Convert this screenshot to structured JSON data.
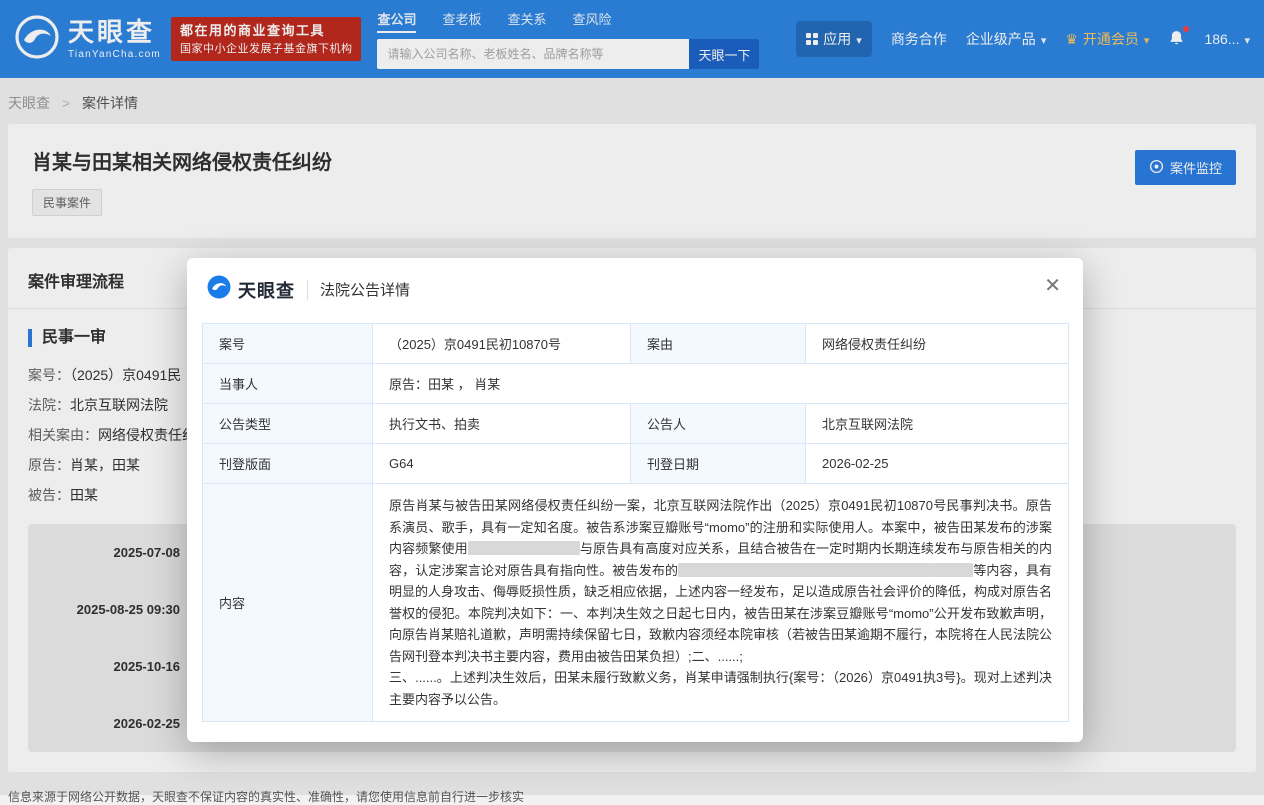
{
  "brand": {
    "name": "天眼查",
    "domain": "TianYanCha.com"
  },
  "header": {
    "badge_line1": "都在用的商业查询工具",
    "badge_line2": "国家中小企业发展子基金旗下机构",
    "search_tabs": [
      {
        "label": "查公司"
      },
      {
        "label": "查老板"
      },
      {
        "label": "查关系"
      },
      {
        "label": "查风险"
      }
    ],
    "search_placeholder": "请输入公司名称、老板姓名、品牌名称等",
    "search_button": "天眼一下",
    "nav_app": "应用",
    "nav_biz": "商务合作",
    "nav_enterprise": "企业级产品",
    "nav_vip": "开通会员",
    "nav_phone": "186..."
  },
  "breadcrumb": {
    "home": "天眼查",
    "separator": ">",
    "current": "案件详情"
  },
  "case_header": {
    "title": "肖某与田某相关网络侵权责任纠纷",
    "tag": "民事案件",
    "monitor_button": "案件监控"
  },
  "case_flow": {
    "section_title": "案件审理流程",
    "stage": "民事一审",
    "fields": [
      {
        "label": "案号：",
        "value": "（2025）京0491民"
      },
      {
        "label": "法院：",
        "value": "北京互联网法院"
      },
      {
        "label": "相关案由：",
        "value": "网络侵权责任纠"
      },
      {
        "label": "原告：",
        "value": "肖某，田某"
      },
      {
        "label": "被告：",
        "value": "田某"
      }
    ],
    "timeline": [
      {
        "date": "2025-07-08"
      },
      {
        "date": "2025-08-25 09:30"
      },
      {
        "date": "2025-10-16"
      },
      {
        "date": "2026-02-25"
      }
    ]
  },
  "modal": {
    "brand": "天眼查",
    "title": "法院公告详情",
    "close_icon": "✕",
    "table": {
      "row1": {
        "label1": "案号",
        "value1": "（2025）京0491民初10870号",
        "label2": "案由",
        "value2": "网络侵权责任纠纷"
      },
      "row2": {
        "label1": "当事人",
        "value1": "原告：田某 ， 肖某"
      },
      "row3": {
        "label1": "公告类型",
        "value1": "执行文书、拍卖",
        "label2": "公告人",
        "value2": "北京互联网法院"
      },
      "row4": {
        "label1": "刊登版面",
        "value1": "G64",
        "label2": "刊登日期",
        "value2": "2026-02-25"
      },
      "row5_label": "内容"
    },
    "content_segments": [
      {
        "text": "原告肖某与被告田某网络侵权责任纠纷一案，北京互联网法院作出（2025）京0491民初10870号民事判决书。原告系演员、歌手，具有一定知名度。被告系涉案豆瓣账号“momo”的注册和实际使用人。本案中，被告田某发布的涉案内容频繁使用"
      },
      {
        "redact": 112
      },
      {
        "text": "与原告具有高度对应关系，且结合被告在一定时期内长期连续发布与原告相关的内容，认定涉案言论对原告具有指向性。被告发布的"
      },
      {
        "redact": 255
      },
      {
        "redact": 40
      },
      {
        "text": "等内容，具有明显的人身攻击、侮辱贬损性质，缺乏相应依据，上述内容一经发布，足以造成原告社会评价的降低，构成对原告名誉权的侵犯。本院判决如下：一、本判决生效之日起七日内，被告田某在涉案豆瓣账号“momo”公开发布致歉声明，向原告肖某赔礼道歉，声明需持续保留七日，致歉内容须经本院审核（若被告田某逾期不履行，本院将在人民法院公告网刊登本判决书主要内容，费用由被告田某负担）;二、......;"
      },
      {
        "br": true
      },
      {
        "text": "三、......。上述判决生效后，田某未履行致歉义务，肖某申请强制执行{案号：（2026）京0491执3号}。现对上述判决主要内容予以公告。"
      }
    ]
  },
  "footer": {
    "disclaimer": "信息来源于网络公开数据，天眼查不保证内容的真实性、准确性，请您使用信息前自行进一步核实"
  },
  "colors": {
    "header_blue": "#2e86e4",
    "accent_blue": "#2b7de2",
    "badge_red": "#bf2a1f",
    "vip_gold": "#ffc95e",
    "table_border": "#d9e6f4",
    "table_label_bg": "#f3f9fe"
  }
}
